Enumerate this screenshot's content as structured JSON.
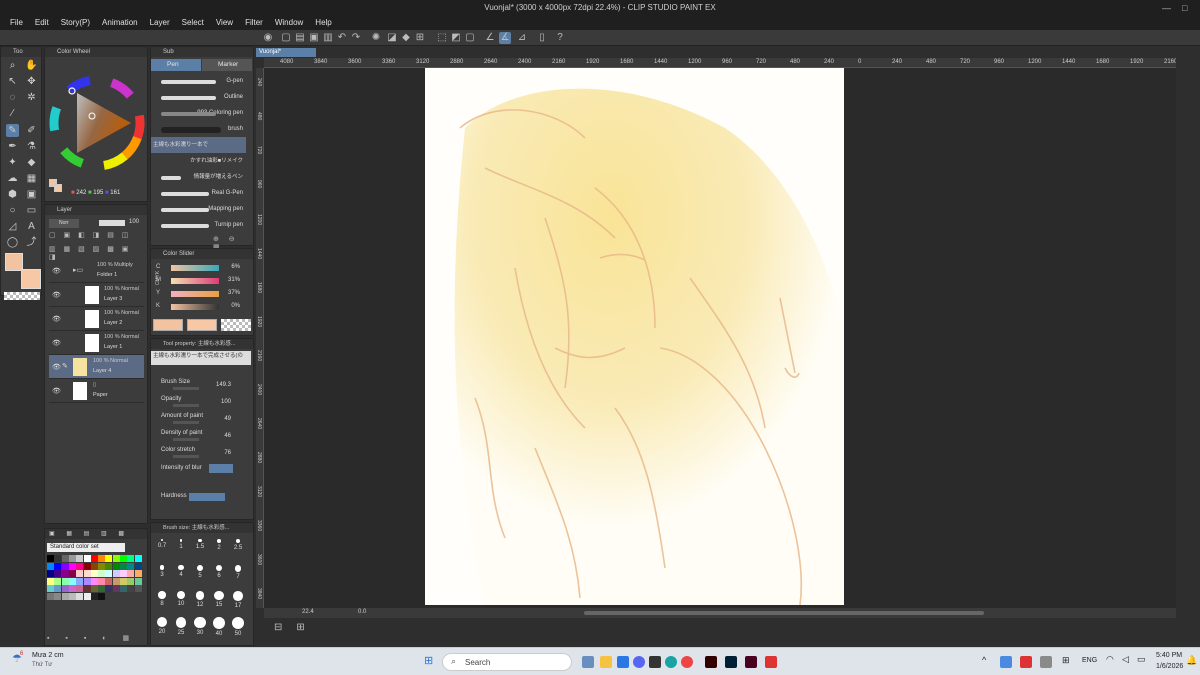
{
  "title": "Vuonjal* (3000 x 4000px 72dpi 22.4%) - CLIP STUDIO PAINT EX",
  "menu": [
    "File",
    "Edit",
    "Story(P)",
    "Animation",
    "Layer",
    "Select",
    "View",
    "Filter",
    "Window",
    "Help"
  ],
  "panels": {
    "tool_tab": "Too",
    "color_wheel_tab": "Color Wheel",
    "sub_tab": "Sub",
    "canvas_tab": "Vuonjal*",
    "layer_tab": "Layer",
    "color_slider_tab": "Color Slider",
    "tool_property_tab": "Tool property: 主線も水彩感...",
    "brush_size_tab": "Brush size: 主線も水彩感...",
    "color_set_select": "Standard color set"
  },
  "rgb": {
    "r": "242",
    "g": "195",
    "b": "161"
  },
  "sub_tool": {
    "tabs": [
      "Pen",
      "Marker"
    ],
    "brushes": [
      "G-pen",
      "Outline",
      "993 Coloring pen",
      "brush",
      "主線も水彩濡り一本で",
      "かすれ油彩■リメイク",
      "情報量が増えるペン",
      "Real G-Pen",
      "Mapping pen",
      "Turnip pen"
    ]
  },
  "layers": {
    "blend_select": "Norr",
    "opacity": "100",
    "items": [
      {
        "mode": "100 % Multiply",
        "name": "Folder 1"
      },
      {
        "mode": "100 % Normal",
        "name": "Layer 3"
      },
      {
        "mode": "100 % Normal",
        "name": "Layer 2"
      },
      {
        "mode": "100 % Normal",
        "name": "Layer 1"
      },
      {
        "mode": "100 % Normal",
        "name": "Layer 4"
      },
      {
        "mode": "",
        "name": "Paper"
      }
    ]
  },
  "cmyk": {
    "mode_label": "CMYK",
    "rows": [
      {
        "label": "C",
        "value": "6%"
      },
      {
        "label": "M",
        "value": "31%"
      },
      {
        "label": "Y",
        "value": "37%"
      },
      {
        "label": "K",
        "value": "0%"
      }
    ]
  },
  "tool_property": {
    "brush_name": "主線も水彩濡り一本で完成させる(の",
    "props": [
      {
        "label": "Brush Size",
        "value": "149.3"
      },
      {
        "label": "Opacity",
        "value": "100"
      },
      {
        "label": "Amount of paint",
        "value": "49"
      },
      {
        "label": "Density of paint",
        "value": "46"
      },
      {
        "label": "Color stretch",
        "value": "76"
      },
      {
        "label": "Intensity of blur",
        "value": ""
      }
    ],
    "hardness": "Hardness"
  },
  "brush_sizes": [
    "0.7",
    "1",
    "1.5",
    "2",
    "2.5",
    "3",
    "4",
    "5",
    "6",
    "7",
    "8",
    "10",
    "12",
    "15",
    "17",
    "20",
    "25",
    "30",
    "40",
    "50"
  ],
  "ruler_h": [
    "4080",
    "3840",
    "3600",
    "3360",
    "3120",
    "2880",
    "2640",
    "2400",
    "2160",
    "1920",
    "1680",
    "1440",
    "1200",
    "960",
    "720",
    "480",
    "240",
    "0",
    "240",
    "480",
    "720",
    "960",
    "1200",
    "1440",
    "1680",
    "1920",
    "2160"
  ],
  "ruler_v": [
    "240",
    "480",
    "720",
    "960",
    "1200",
    "1440",
    "1680",
    "1920",
    "2160",
    "2400",
    "2640",
    "2880",
    "3120",
    "3360",
    "3600",
    "3840"
  ],
  "status": {
    "zoom": "22.4",
    "angle": "0.0"
  },
  "taskbar": {
    "weather_temp": "Mưa 2 cm",
    "weather_day": "Thứ Tư",
    "weather_badge": "6",
    "search": "Search",
    "lang": "ENG",
    "time": "5:40 PM",
    "date": "1/6/2026"
  },
  "colors": {
    "main_color": "#f2c3a1",
    "sub_color": "#f6c8a6",
    "accent": "#5b7fa6"
  }
}
